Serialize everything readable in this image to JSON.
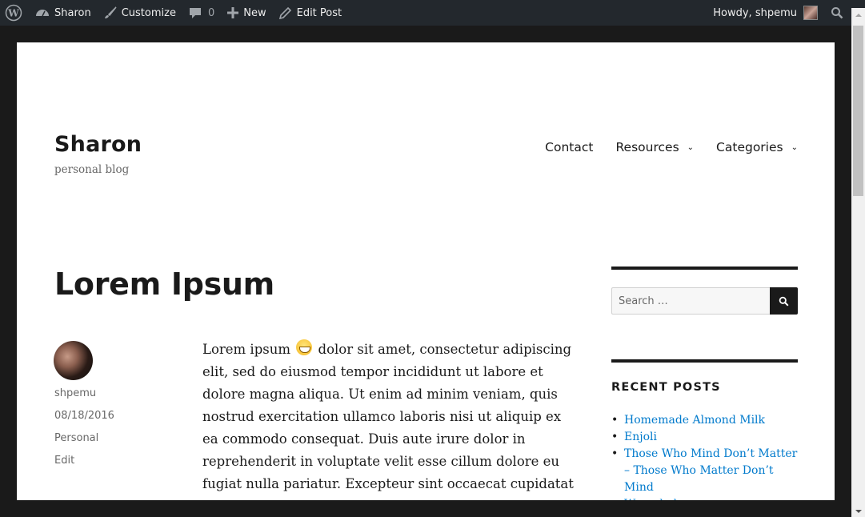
{
  "adminbar": {
    "site_name": "Sharon",
    "customize": "Customize",
    "comments_count": "0",
    "new": "New",
    "edit_post": "Edit Post",
    "howdy": "Howdy, shpemu"
  },
  "site": {
    "title": "Sharon",
    "description": "personal blog"
  },
  "nav": {
    "items": [
      {
        "label": "Contact",
        "has_submenu": false
      },
      {
        "label": "Resources",
        "has_submenu": true
      },
      {
        "label": "Categories",
        "has_submenu": true
      }
    ]
  },
  "post": {
    "title": "Lorem Ipsum",
    "author": "shpemu",
    "date": "08/18/2016",
    "category": "Personal",
    "edit": "Edit",
    "content_before_emoji": "Lorem ipsum",
    "content_after_emoji": "dolor sit amet, consectetur adipiscing elit, sed do eiusmod tempor incididunt ut labore et dolore magna aliqua. Ut enim ad minim veniam, quis nostrud exercitation ullamco laboris nisi ut aliquip ex ea commodo consequat. Duis aute irure dolor in reprehenderit in voluptate velit esse cillum dolore eu fugiat nulla pariatur. Excepteur sint occaecat cupidatat"
  },
  "sidebar": {
    "search_placeholder": "Search …",
    "recent_posts_title": "RECENT POSTS",
    "recent_posts": [
      "Homemade Almond Milk",
      "Enjoli",
      "Those Who Mind Don’t Matter – Those Who Matter Don’t Mind",
      "Wounded"
    ]
  },
  "colors": {
    "adminbar_bg": "#23282d",
    "link": "#007acc",
    "text": "#1a1a1a",
    "meta": "#686868"
  }
}
